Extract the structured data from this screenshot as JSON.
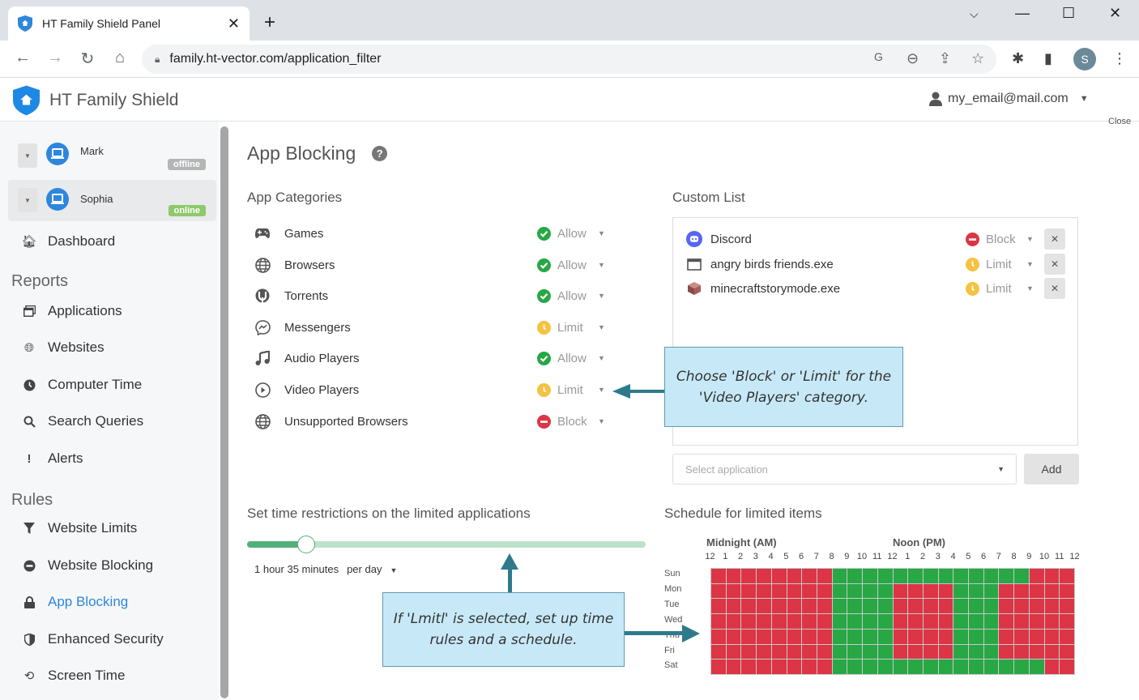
{
  "browser": {
    "tab_title": "HT Family Shield Panel",
    "url": "family.ht-vector.com/application_filter",
    "profile_initial": "S"
  },
  "app": {
    "brand": "HT Family Shield",
    "user_email": "my_email@mail.com",
    "close_label": "Close"
  },
  "devices": [
    {
      "name": "Mark",
      "status": "offline",
      "status_color": "#b5b5b5",
      "active": false
    },
    {
      "name": "Sophia",
      "status": "online",
      "status_color": "#8dc96a",
      "active": true
    }
  ],
  "sidebar": {
    "dashboard": "Dashboard",
    "reports_heading": "Reports",
    "reports": [
      {
        "label": "Applications",
        "icon": "applications-icon"
      },
      {
        "label": "Websites",
        "icon": "globe-icon"
      },
      {
        "label": "Computer Time",
        "icon": "clock-icon"
      },
      {
        "label": "Search Queries",
        "icon": "search-icon"
      },
      {
        "label": "Alerts",
        "icon": "exclamation-icon"
      }
    ],
    "rules_heading": "Rules",
    "rules": [
      {
        "label": "Website Limits",
        "icon": "filter-icon"
      },
      {
        "label": "Website Blocking",
        "icon": "minus-circle-icon"
      },
      {
        "label": "App Blocking",
        "icon": "lock-icon",
        "active": true
      },
      {
        "label": "Enhanced Security",
        "icon": "shield-icon"
      },
      {
        "label": "Screen Time",
        "icon": "history-icon"
      }
    ]
  },
  "main": {
    "title": "App Blocking",
    "categories_heading": "App Categories",
    "categories": [
      {
        "label": "Games",
        "icon": "gamepad-icon",
        "status": "Allow"
      },
      {
        "label": "Browsers",
        "icon": "globe-icon",
        "status": "Allow"
      },
      {
        "label": "Torrents",
        "icon": "utorrent-icon",
        "status": "Allow"
      },
      {
        "label": "Messengers",
        "icon": "messenger-icon",
        "status": "Limit"
      },
      {
        "label": "Audio Players",
        "icon": "music-icon",
        "status": "Allow"
      },
      {
        "label": "Video Players",
        "icon": "play-circle-icon",
        "status": "Limit"
      },
      {
        "label": "Unsupported Browsers",
        "icon": "globe-icon",
        "status": "Block"
      }
    ],
    "custom_heading": "Custom List",
    "custom_list": [
      {
        "label": "Discord",
        "icon": "discord-icon",
        "status": "Block"
      },
      {
        "label": "angry birds friends.exe",
        "icon": "window-icon",
        "status": "Limit"
      },
      {
        "label": "minecraftstorymode.exe",
        "icon": "minecraft-icon",
        "status": "Limit"
      }
    ],
    "select_placeholder": "Select application",
    "add_label": "Add",
    "time_heading": "Set time restrictions on the limited applications",
    "time_value": "1 hour 35 minutes",
    "time_fraction": 0.149,
    "time_period": "per day",
    "schedule_heading": "Schedule for limited items",
    "schedule": {
      "am_label": "Midnight (AM)",
      "pm_label": "Noon (PM)",
      "hours": [
        "12",
        "1",
        "2",
        "3",
        "4",
        "5",
        "6",
        "7",
        "8",
        "9",
        "10",
        "11",
        "12",
        "1",
        "2",
        "3",
        "4",
        "5",
        "6",
        "7",
        "8",
        "9",
        "10",
        "11",
        "12"
      ],
      "days": [
        "Sun",
        "Mon",
        "Tue",
        "Wed",
        "Thu",
        "Fri",
        "Sat"
      ],
      "allowed_ranges": {
        "Sun": [
          [
            8,
            20
          ]
        ],
        "Mon": [
          [
            8,
            11
          ],
          [
            16,
            18
          ]
        ],
        "Tue": [
          [
            8,
            11
          ],
          [
            16,
            18
          ]
        ],
        "Wed": [
          [
            8,
            11
          ],
          [
            16,
            18
          ]
        ],
        "Thu": [
          [
            8,
            11
          ],
          [
            16,
            18
          ]
        ],
        "Fri": [
          [
            8,
            11
          ],
          [
            16,
            18
          ]
        ],
        "Sat": [
          [
            8,
            21
          ]
        ]
      }
    }
  },
  "status_colors": {
    "Allow": "#28a745",
    "Limit": "#f5c242",
    "Block": "#dc3545"
  },
  "schedule_colors": {
    "allowed": "#28a745",
    "blocked": "#dc3545"
  },
  "callouts": {
    "top": "Choose 'Block' or 'Limit' for the 'Video Players' category.",
    "bottom": "If 'Lmitl' is selected, set up time rules and a schedule."
  }
}
